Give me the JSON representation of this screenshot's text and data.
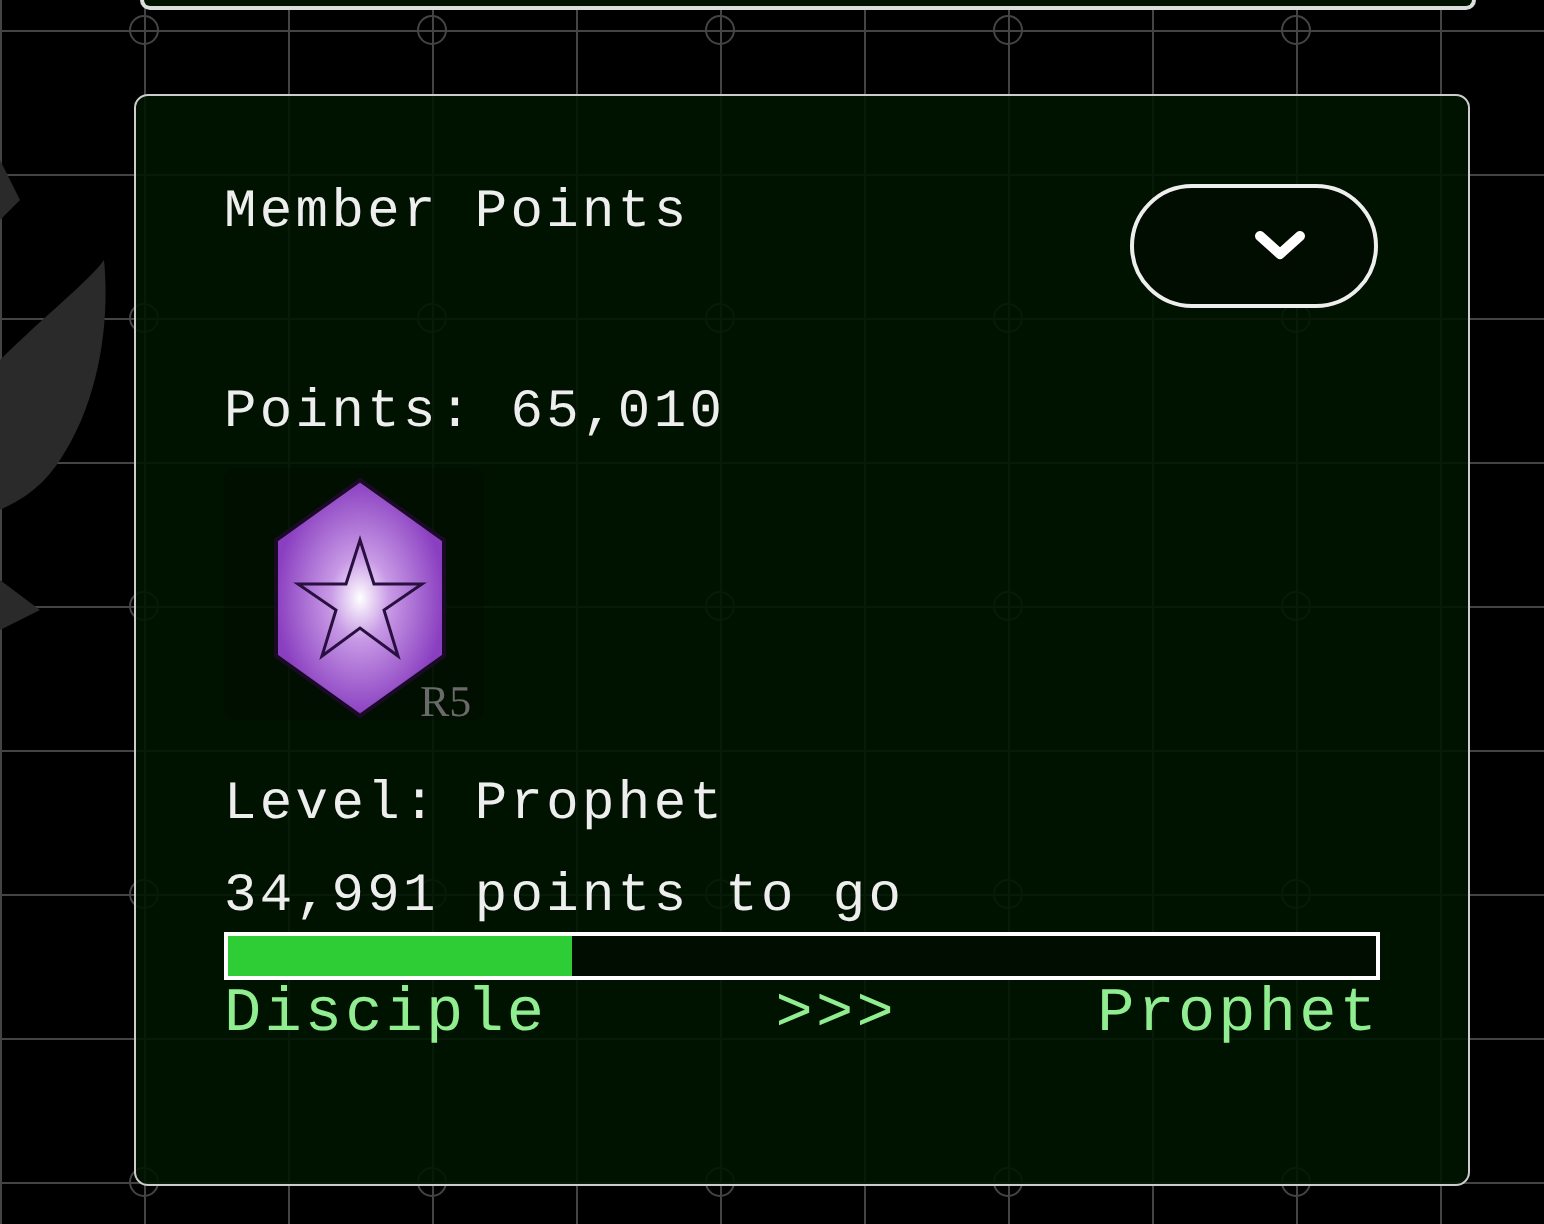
{
  "card": {
    "title": "Member Points",
    "menu_button": {
      "expanded": false
    },
    "points": "Points: 65,010",
    "badge": {
      "label": "R5"
    },
    "level_text": "Level: Prophet",
    "remaining": "34,991 points to go",
    "progress": {
      "level": 0.3
    },
    "from_level": "Disciple",
    "arrow": ">>>",
    "to_level": "Prophet"
  }
}
